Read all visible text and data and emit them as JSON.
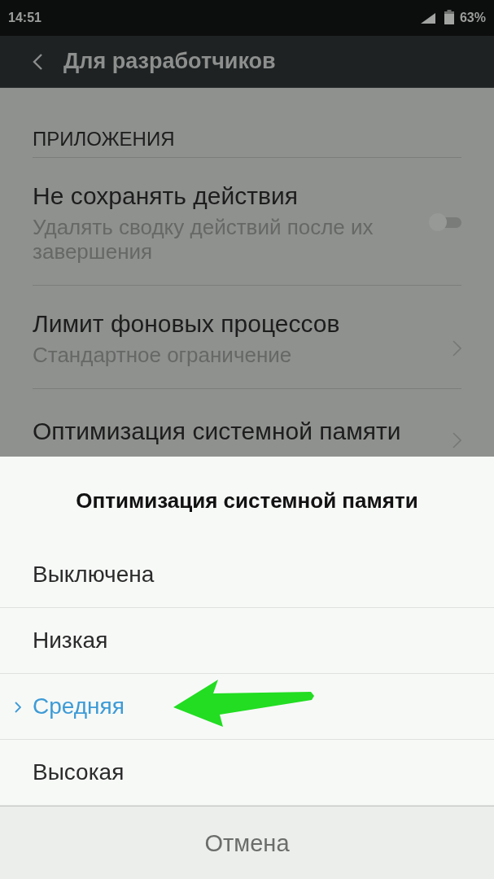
{
  "status_bar": {
    "time": "14:51",
    "battery": "63%"
  },
  "toolbar": {
    "title": "Для разработчиков"
  },
  "settings": {
    "section": "ПРИЛОЖЕНИЯ",
    "items": [
      {
        "kind": "switch",
        "title": "Не сохранять действия",
        "summary": "Удалять сводку действий после их завершения",
        "on": false
      },
      {
        "kind": "link",
        "title": "Лимит фоновых процессов",
        "summary": "Стандартное ограничение"
      },
      {
        "kind": "link",
        "title": "Оптимизация системной памяти"
      }
    ]
  },
  "dialog": {
    "title": "Оптимизация системной памяти",
    "options": [
      {
        "label": "Выключена",
        "selected": false
      },
      {
        "label": "Низкая",
        "selected": false
      },
      {
        "label": "Средняя",
        "selected": true
      },
      {
        "label": "Высокая",
        "selected": false
      }
    ],
    "cancel": "Отмена"
  }
}
